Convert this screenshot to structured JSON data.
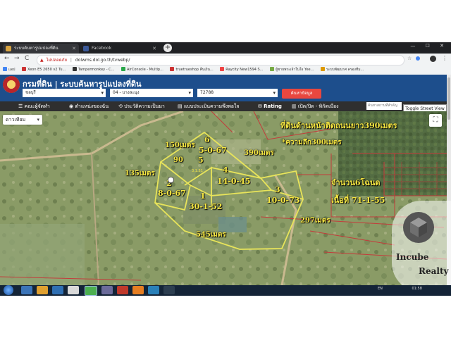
{
  "browser": {
    "tabs": [
      {
        "label": "ระบบค้นหารูปแปลงที่ดิน",
        "favicon_color": "#d9a441",
        "active": true
      },
      {
        "label": "Facebook",
        "favicon_color": "#3b5998",
        "active": false
      }
    ],
    "new_tab": "+",
    "window_controls": "— ☐ ✕",
    "back": "←",
    "forward": "→",
    "reload": "C",
    "security_label": "ไม่ปลอดภัย",
    "url": "dolwms.dol.go.th/tvwebp/",
    "bookmarks": [
      "แอป",
      "Xeon E5 2650 v2 Tu...",
      "Tampermonkey - C...",
      "AirConsole - Multip...",
      "truetrueshop คืนเงิน...",
      "Raycity New1594 S...",
      "ผู้ชายพระเจ้าในใจ Yee...",
      "ระบบพัฒนาศ ครองทีม..."
    ]
  },
  "app": {
    "title": "กรมที่ดิน | ระบบค้นหารูปแปลงที่ดิน",
    "province_select": "ชลบุรี",
    "district_select": "04 - บางละมุง",
    "parcel_input": "72788",
    "search_button": "ค้นหาข้อมูล",
    "menu": [
      "คณะผู้จัดทำ",
      "ตำแหน่งของฉัน",
      "ประวัติความเป็นมา",
      "แบบประเมินความพึงพอใจ",
      "Rating",
      "เปิด/ปิด - พิกัดเมือง"
    ],
    "place_search_placeholder": "ค้นหาสถานที่สำคัญ",
    "toggle_view": "Toggle Street View"
  },
  "map": {
    "map_type": "ดาวเทียม",
    "fullscreen": "⛶",
    "colors": {
      "boundary": "#e8e45a",
      "parcel_lines": "#c43b3b",
      "text": "#f5e642"
    },
    "parcels": [
      {
        "number": "1",
        "area": "30-1-52"
      },
      {
        "number": "2",
        "area": "8-0-67"
      },
      {
        "number": "3",
        "area": "10-0-73"
      },
      {
        "number": "4",
        "area": "14-0-45"
      },
      {
        "number": "5",
        "area": ""
      },
      {
        "number": "6",
        "area": "5-0-67"
      }
    ],
    "measurements": {
      "top_left": "150เมตร",
      "left": "135เมตร",
      "left_small": "90",
      "top_right": "390เมตร",
      "bottom": "545เมตร",
      "bottom_right": "297เมตร",
      "road_front": "ที่ดินด้านหน้าติดถนนยาว390เมตร",
      "depth": "*ความลึก300เมตร"
    },
    "summary_deeds": "จำนวน6โฉนด",
    "summary_area": "เนื้อที่ 71-1-55",
    "tiny_label": "3.1.51"
  },
  "watermark": {
    "line1": "Incube",
    "line2": "Realty"
  },
  "taskbar": {
    "lang": "EN",
    "time": "01:58"
  }
}
